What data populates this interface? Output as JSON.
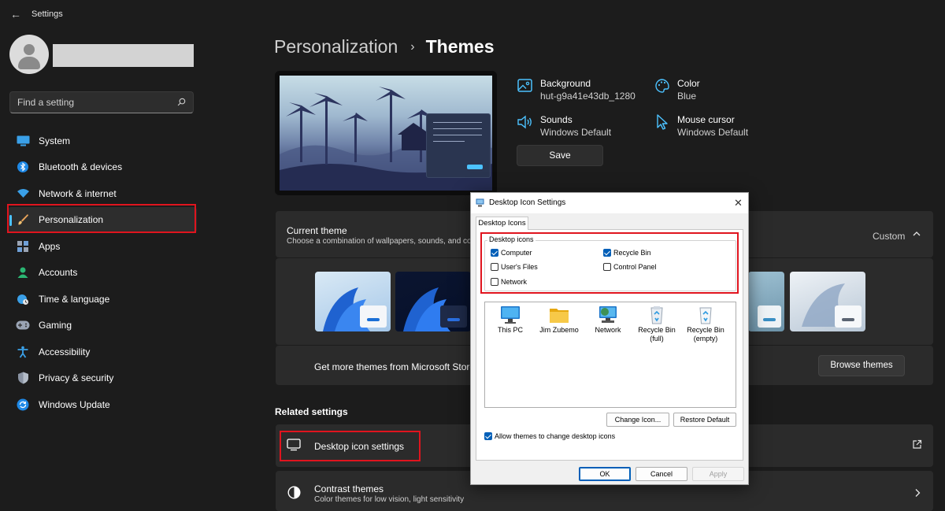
{
  "window": {
    "title": "Settings",
    "back_icon": "back-arrow-icon"
  },
  "sidebar": {
    "user_name": "",
    "search": {
      "placeholder": "Find a setting",
      "icon": "search-icon"
    },
    "items": [
      {
        "label": "System",
        "icon": "system-icon",
        "active": false
      },
      {
        "label": "Bluetooth & devices",
        "icon": "bluetooth-icon",
        "active": false
      },
      {
        "label": "Network & internet",
        "icon": "wifi-icon",
        "active": false
      },
      {
        "label": "Personalization",
        "icon": "paintbrush-icon",
        "active": true
      },
      {
        "label": "Apps",
        "icon": "apps-icon",
        "active": false
      },
      {
        "label": "Accounts",
        "icon": "accounts-icon",
        "active": false
      },
      {
        "label": "Time & language",
        "icon": "globe-clock-icon",
        "active": false
      },
      {
        "label": "Gaming",
        "icon": "gamepad-icon",
        "active": false
      },
      {
        "label": "Accessibility",
        "icon": "accessibility-icon",
        "active": false
      },
      {
        "label": "Privacy & security",
        "icon": "shield-icon",
        "active": false
      },
      {
        "label": "Windows Update",
        "icon": "update-icon",
        "active": false
      }
    ]
  },
  "breadcrumb": {
    "parent": "Personalization",
    "separator": "›",
    "current": "Themes"
  },
  "theme_props": {
    "background": {
      "label": "Background",
      "value": "hut-g9a41e43db_1280",
      "icon": "image-icon"
    },
    "color": {
      "label": "Color",
      "value": "Blue",
      "icon": "palette-icon"
    },
    "sounds": {
      "label": "Sounds",
      "value": "Windows Default",
      "icon": "speaker-icon"
    },
    "cursor": {
      "label": "Mouse cursor",
      "value": "Windows Default",
      "icon": "cursor-icon"
    },
    "save_label": "Save"
  },
  "current_theme": {
    "title": "Current theme",
    "description": "Choose a combination of wallpapers, sounds, and colors together to give your desktop",
    "value": "Custom",
    "store_text": "Get more themes from Microsoft Store",
    "browse_label": "Browse themes"
  },
  "related": {
    "title": "Related settings",
    "desktop_icon": {
      "label": "Desktop icon settings",
      "icon": "monitor-icon",
      "action_icon": "open-external-icon"
    },
    "contrast": {
      "label": "Contrast themes",
      "sub": "Color themes for low vision, light sensitivity",
      "icon": "contrast-icon",
      "action_icon": "chevron-right-icon"
    }
  },
  "dialog": {
    "title": "Desktop Icon Settings",
    "tab": "Desktop Icons",
    "group_label": "Desktop icons",
    "checkboxes": [
      {
        "label": "Computer",
        "checked": true
      },
      {
        "label": "Recycle Bin",
        "checked": true
      },
      {
        "label": "User's Files",
        "checked": false
      },
      {
        "label": "Control Panel",
        "checked": false
      },
      {
        "label": "Network",
        "checked": false
      }
    ],
    "icons": [
      {
        "label": "This PC",
        "icon": "this-pc-icon"
      },
      {
        "label": "Jim Zubemo",
        "icon": "user-folder-icon"
      },
      {
        "label": "Network",
        "icon": "network-icon"
      },
      {
        "label": "Recycle Bin (full)",
        "icon": "recycle-bin-full-icon"
      },
      {
        "label": "Recycle Bin (empty)",
        "icon": "recycle-bin-empty-icon"
      }
    ],
    "change_icon": "Change Icon...",
    "restore_default": "Restore Default",
    "allow_themes": {
      "label": "Allow themes to change desktop icons",
      "checked": true
    },
    "ok": "OK",
    "cancel": "Cancel",
    "apply": "Apply"
  },
  "colors": {
    "accent": "#4cc2ff",
    "highlight_outline": "#e0141e",
    "background": "#1c1c1c",
    "card": "#2b2b2b"
  }
}
